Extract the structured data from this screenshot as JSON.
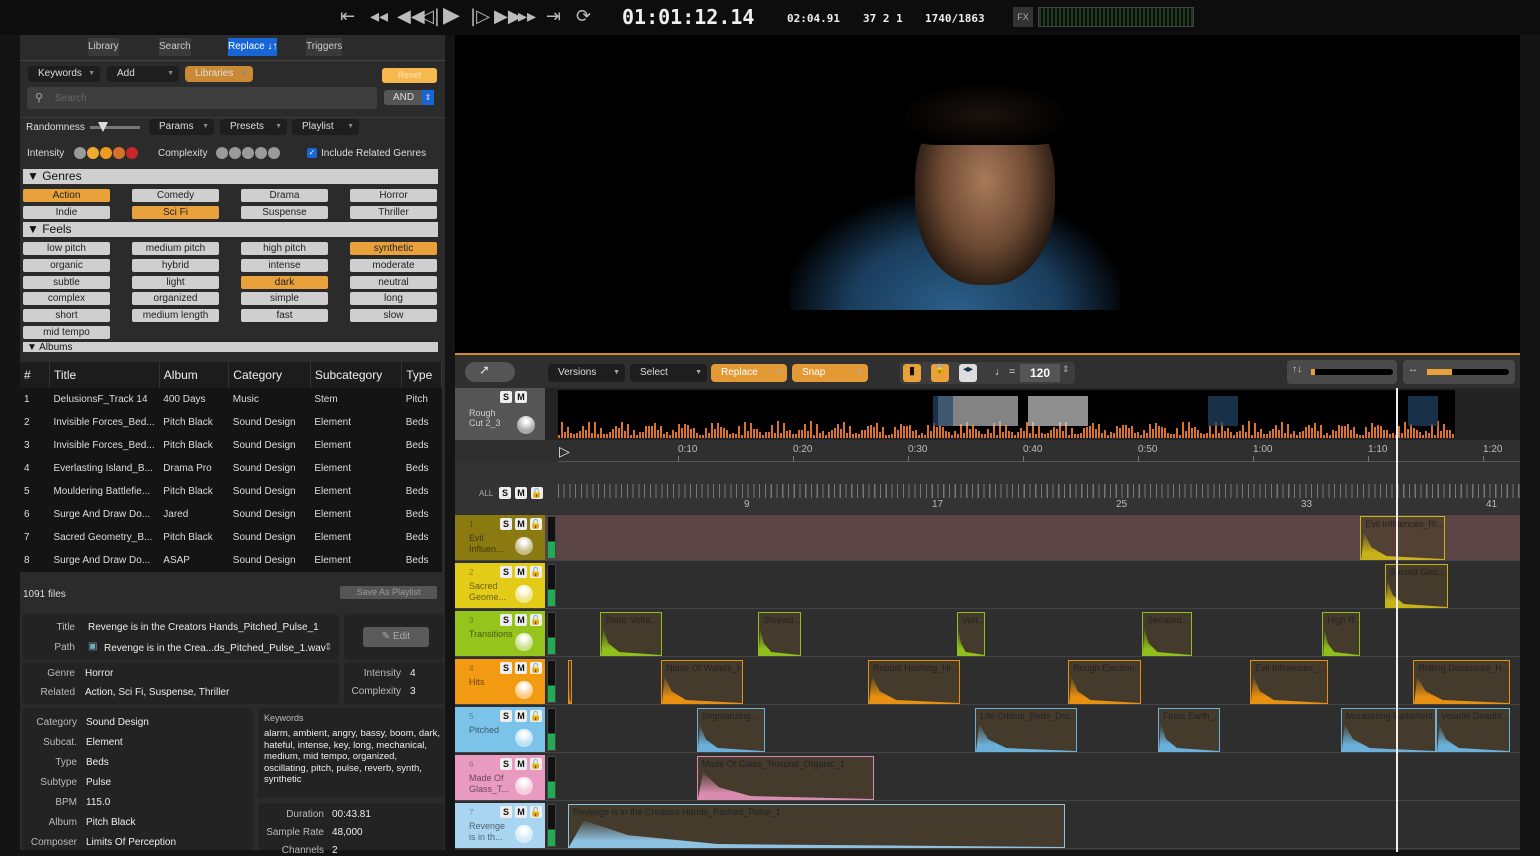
{
  "transport": {
    "timecode": "01:01:12.14",
    "duration": "02:04.91",
    "bars": "37 2 1",
    "frames": "1740/1863",
    "fx_label": "FX",
    "buttons": [
      "skip-start",
      "prev-marker",
      "rewind",
      "step-back",
      "play",
      "step-forward",
      "fast-forward",
      "next-marker",
      "skip-end",
      "loop"
    ]
  },
  "left": {
    "tabs": [
      {
        "label": "Library",
        "active": false
      },
      {
        "label": "Search",
        "active": false
      },
      {
        "label": "Replace ↓↑",
        "active": true
      },
      {
        "label": "Triggers",
        "active": false
      }
    ],
    "keywords_label": "Keywords",
    "add_label": "Add",
    "libraries_label": "Libraries",
    "reset_label": "Reset",
    "search_placeholder": "Search",
    "and_label": "AND",
    "randomness_label": "Randomness",
    "params_label": "Params",
    "presets_label": "Presets",
    "playlist_label": "Playlist",
    "intensity_label": "Intensity",
    "complexity_label": "Complexity",
    "include_related_label": "Include Related Genres",
    "include_related_checked": true,
    "intensity_colors": [
      "#9a9a9a",
      "#f0a830",
      "#f09a20",
      "#d9702a",
      "#c8282a"
    ],
    "genres_title": "▼ Genres",
    "genres": [
      {
        "label": "Action",
        "on": true
      },
      {
        "label": "Comedy",
        "on": false
      },
      {
        "label": "Drama",
        "on": false
      },
      {
        "label": "Horror",
        "on": false
      },
      {
        "label": "Indie",
        "on": false
      },
      {
        "label": "Sci Fi",
        "on": true
      },
      {
        "label": "Suspense",
        "on": false
      },
      {
        "label": "Thriller",
        "on": false
      }
    ],
    "feels_title": "▼ Feels",
    "feels": [
      {
        "label": "low pitch",
        "on": false
      },
      {
        "label": "medium pitch",
        "on": false
      },
      {
        "label": "high pitch",
        "on": false
      },
      {
        "label": "synthetic",
        "on": true
      },
      {
        "label": "organic",
        "on": false
      },
      {
        "label": "hybrid",
        "on": false
      },
      {
        "label": "intense",
        "on": false
      },
      {
        "label": "moderate",
        "on": false
      },
      {
        "label": "subtle",
        "on": false
      },
      {
        "label": "light",
        "on": false
      },
      {
        "label": "dark",
        "on": true
      },
      {
        "label": "neutral",
        "on": false
      },
      {
        "label": "complex",
        "on": false
      },
      {
        "label": "organized",
        "on": false
      },
      {
        "label": "simple",
        "on": false
      },
      {
        "label": "long",
        "on": false
      },
      {
        "label": "short",
        "on": false
      },
      {
        "label": "medium length",
        "on": false
      },
      {
        "label": "fast",
        "on": false
      },
      {
        "label": "slow",
        "on": false
      },
      {
        "label": "mid tempo",
        "on": false
      }
    ],
    "albums_title": "▼ Albums"
  },
  "table": {
    "columns": [
      "#",
      "Title",
      "Album",
      "Category",
      "Subcategory",
      "Type"
    ],
    "rows": [
      [
        "1",
        "DelusionsF_Track 14",
        "400 Days",
        "Music",
        "Stem",
        "Pitch"
      ],
      [
        "2",
        "Invisible Forces_Bed...",
        "Pitch Black",
        "Sound Design",
        "Element",
        "Beds"
      ],
      [
        "3",
        "Invisible Forces_Bed...",
        "Pitch Black",
        "Sound Design",
        "Element",
        "Beds"
      ],
      [
        "4",
        "Everlasting Island_B...",
        "Drama Pro",
        "Sound Design",
        "Element",
        "Beds"
      ],
      [
        "5",
        "Mouldering Battlefie...",
        "Pitch Black",
        "Sound Design",
        "Element",
        "Beds"
      ],
      [
        "6",
        "Surge And Draw Do...",
        "Jared",
        "Sound Design",
        "Element",
        "Beds"
      ],
      [
        "7",
        "Sacred Geometry_B...",
        "Pitch Black",
        "Sound Design",
        "Element",
        "Beds"
      ],
      [
        "8",
        "Surge And Draw Do...",
        "ASAP",
        "Sound Design",
        "Element",
        "Beds"
      ]
    ],
    "file_count": "1091 files",
    "save_playlist_label": "Save As Playlist"
  },
  "details": {
    "title_label": "Title",
    "title": "Revenge is in the Creators Hands_Pitched_Pulse_1",
    "path_label": "Path",
    "path": "Revenge is in the Crea...ds_Pitched_Pulse_1.wav",
    "edit_label": "✎ Edit",
    "genre_label": "Genre",
    "genre": "Horror",
    "related_label": "Related",
    "related": "Action, Sci Fi, Suspense, Thriller",
    "intensity_label": "Intensity",
    "intensity": "4",
    "complexity_label": "Complexity",
    "complexity": "3",
    "fields": [
      {
        "label": "Category",
        "value": "Sound Design"
      },
      {
        "label": "Subcat.",
        "value": "Element"
      },
      {
        "label": "Type",
        "value": "Beds"
      },
      {
        "label": "Subtype",
        "value": "Pulse"
      },
      {
        "label": "BPM",
        "value": "115.0"
      },
      {
        "label": "Album",
        "value": "Pitch Black"
      },
      {
        "label": "Composer",
        "value": "Limits Of Perception"
      }
    ],
    "keywords_label": "Keywords",
    "keywords": "alarm, ambient, angry, bassy, boom, dark, hateful, intense, key, long, mechanical, medium, mid tempo, organized, oscillating, pitch, pulse, reverb, synth, synthetic",
    "duration_label": "Duration",
    "duration": "00:43.81",
    "sample_rate_label": "Sample Rate",
    "sample_rate": "48,000",
    "channels_label": "Channels",
    "channels": "2"
  },
  "timeline": {
    "versions_label": "Versions",
    "select_label": "Select",
    "replace_label": "Replace",
    "snap_label": "Snap",
    "tempo_symbol": "♩ =",
    "tempo": "120",
    "vertical_zoom": 0.05,
    "horizontal_zoom": 0.3,
    "video_track": {
      "name": "Rough Cut 2_3"
    },
    "all_label": "ALL",
    "time_labels": [
      "0:10",
      "0:20",
      "0:30",
      "0:40",
      "0:50",
      "1:00",
      "1:10",
      "1:20"
    ],
    "bar_labels": [
      "9",
      "17",
      "25",
      "33",
      "41"
    ],
    "playhead_seconds": 72.0,
    "tracks": [
      {
        "num": "1",
        "name": "Evil Influen...",
        "color": "#8a7a10",
        "clip_color": "#c8b418",
        "clips": [
          {
            "name": "Evil Influences_Ri...",
            "start": 68.9,
            "end": 76.3
          }
        ]
      },
      {
        "num": "2",
        "name": "Sacred Geome...",
        "color": "#e2cc18",
        "clip_color": "#c8b418",
        "clips": [
          {
            "name": "Sacred Geo...",
            "start": 71.0,
            "end": 76.5
          }
        ]
      },
      {
        "num": "3",
        "name": "Transitions",
        "color": "#95c51c",
        "clip_color": "#8fbf1a",
        "clips": [
          {
            "name": "Static Volta...",
            "start": 2.8,
            "end": 8.2
          },
          {
            "name": "Shrewd...",
            "start": 16.5,
            "end": 20.3
          },
          {
            "name": "Vert...",
            "start": 33.8,
            "end": 36.3
          },
          {
            "name": "Serrated...",
            "start": 49.9,
            "end": 54.3
          },
          {
            "name": "High R...",
            "start": 65.6,
            "end": 68.9
          }
        ]
      },
      {
        "num": "4",
        "name": "Hits",
        "color": "#f29a12",
        "clip_color": "#e8900f",
        "clips": [
          {
            "name": "H...",
            "start": 0,
            "end": 0.3
          },
          {
            "name": "Noise Of Waters_Hi...",
            "start": 8.1,
            "end": 15.2
          },
          {
            "name": "Robust Hashing_Hi...",
            "start": 26.1,
            "end": 34.1
          },
          {
            "name": "Rough Ejection...",
            "start": 43.5,
            "end": 49.8
          },
          {
            "name": "Evil Influences_...",
            "start": 59.3,
            "end": 66.1
          },
          {
            "name": "Rolling Disclosure_H...",
            "start": 73.5,
            "end": 81.9
          }
        ]
      },
      {
        "num": "5",
        "name": "Pitched",
        "color": "#7cc3ea",
        "clip_color": "#6bb0da",
        "clips": [
          {
            "name": "Stigmatizing...",
            "start": 11.2,
            "end": 17.1
          },
          {
            "name": "Life Critical_Beds_Dro...",
            "start": 35.4,
            "end": 44.3
          },
          {
            "name": "Fetus Earth_...",
            "start": 51.3,
            "end": 56.7
          },
          {
            "name": "Mouldering Battlefield",
            "start": 67.2,
            "end": 75.5
          },
          {
            "name": "Volatile Deadbl...",
            "start": 75.5,
            "end": 81.9
          }
        ]
      },
      {
        "num": "6",
        "name": "Made Of Glass_T...",
        "color": "#e99ac0",
        "clip_color": "#d98cb0",
        "clips": [
          {
            "name": "Made Of Glass_Textural_Organic_1",
            "start": 11.2,
            "end": 26.6
          }
        ]
      },
      {
        "num": "7",
        "name": "Revenge is in th...",
        "color": "#a9d5f0",
        "clip_color": "#8ec2e2",
        "clips": [
          {
            "name": "Revenge is in the Creators Hands_Pitched_Pulse_1",
            "start": 0,
            "end": 43.2
          }
        ]
      }
    ]
  }
}
